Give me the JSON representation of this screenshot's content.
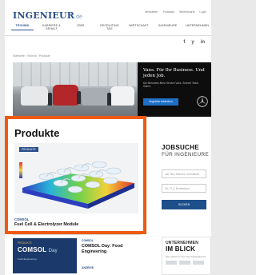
{
  "site": {
    "logo": "INGENIEUR",
    "logo_tld": ".de"
  },
  "top_links": [
    "Newsletter",
    "Podcasts",
    "Stellenmarkt",
    "Login"
  ],
  "nav": [
    {
      "label": "Technik",
      "active": true
    },
    {
      "label": "Karriere & Gehalt",
      "active": false
    },
    {
      "label": "Jobs",
      "active": false
    },
    {
      "label": "Recruiting Tag",
      "active": false
    },
    {
      "label": "Wirtschaft",
      "active": false
    },
    {
      "label": "Ingenieure",
      "active": false
    },
    {
      "label": "Unternehmen",
      "active": false
    }
  ],
  "social": [
    "f",
    "y",
    "in"
  ],
  "breadcrumb": "Startseite  ›  Technik  ›  Produkte",
  "ad": {
    "headline": "Vans. Für Ihr Business. Und jeden Job.",
    "sub": "Die Mercedes-Benz Service Vans. Schnell. Stark. Sicher.",
    "cta": "Angebote entdecken"
  },
  "products": {
    "title": "Produkte",
    "badge": "PRODUKTE",
    "caption": "COMSOL",
    "name": "Fuel Cell & Electrolyzer Module"
  },
  "jobs": {
    "title": "JOBSUCHE",
    "subtitle": "FÜR INGENIEURE",
    "field1": "Job Titel, Branche, Kenntnisse",
    "field2": "Ort, PLZ, Bundesland",
    "button": "SUCHEN"
  },
  "comsol_ad": {
    "pre": "PRODUKTE",
    "logo": "COMSOL",
    "logo_sub": "Day",
    "text": "Food Engineering"
  },
  "comsol_article": {
    "kicker": "COMSOL",
    "headline": "COMSOL Day: Food Engineering"
  },
  "second_kicker": "ANZEIGE",
  "unternehmen": {
    "line1": "UNTERNEHMEN",
    "line2": "IM BLICK",
    "sub": "Wer gehört zu den Top-Arbeitgebern?"
  },
  "colors": {
    "brand": "#2a4f8a",
    "highlight": "#ee5a12",
    "ad_button": "#1f6fc7"
  }
}
